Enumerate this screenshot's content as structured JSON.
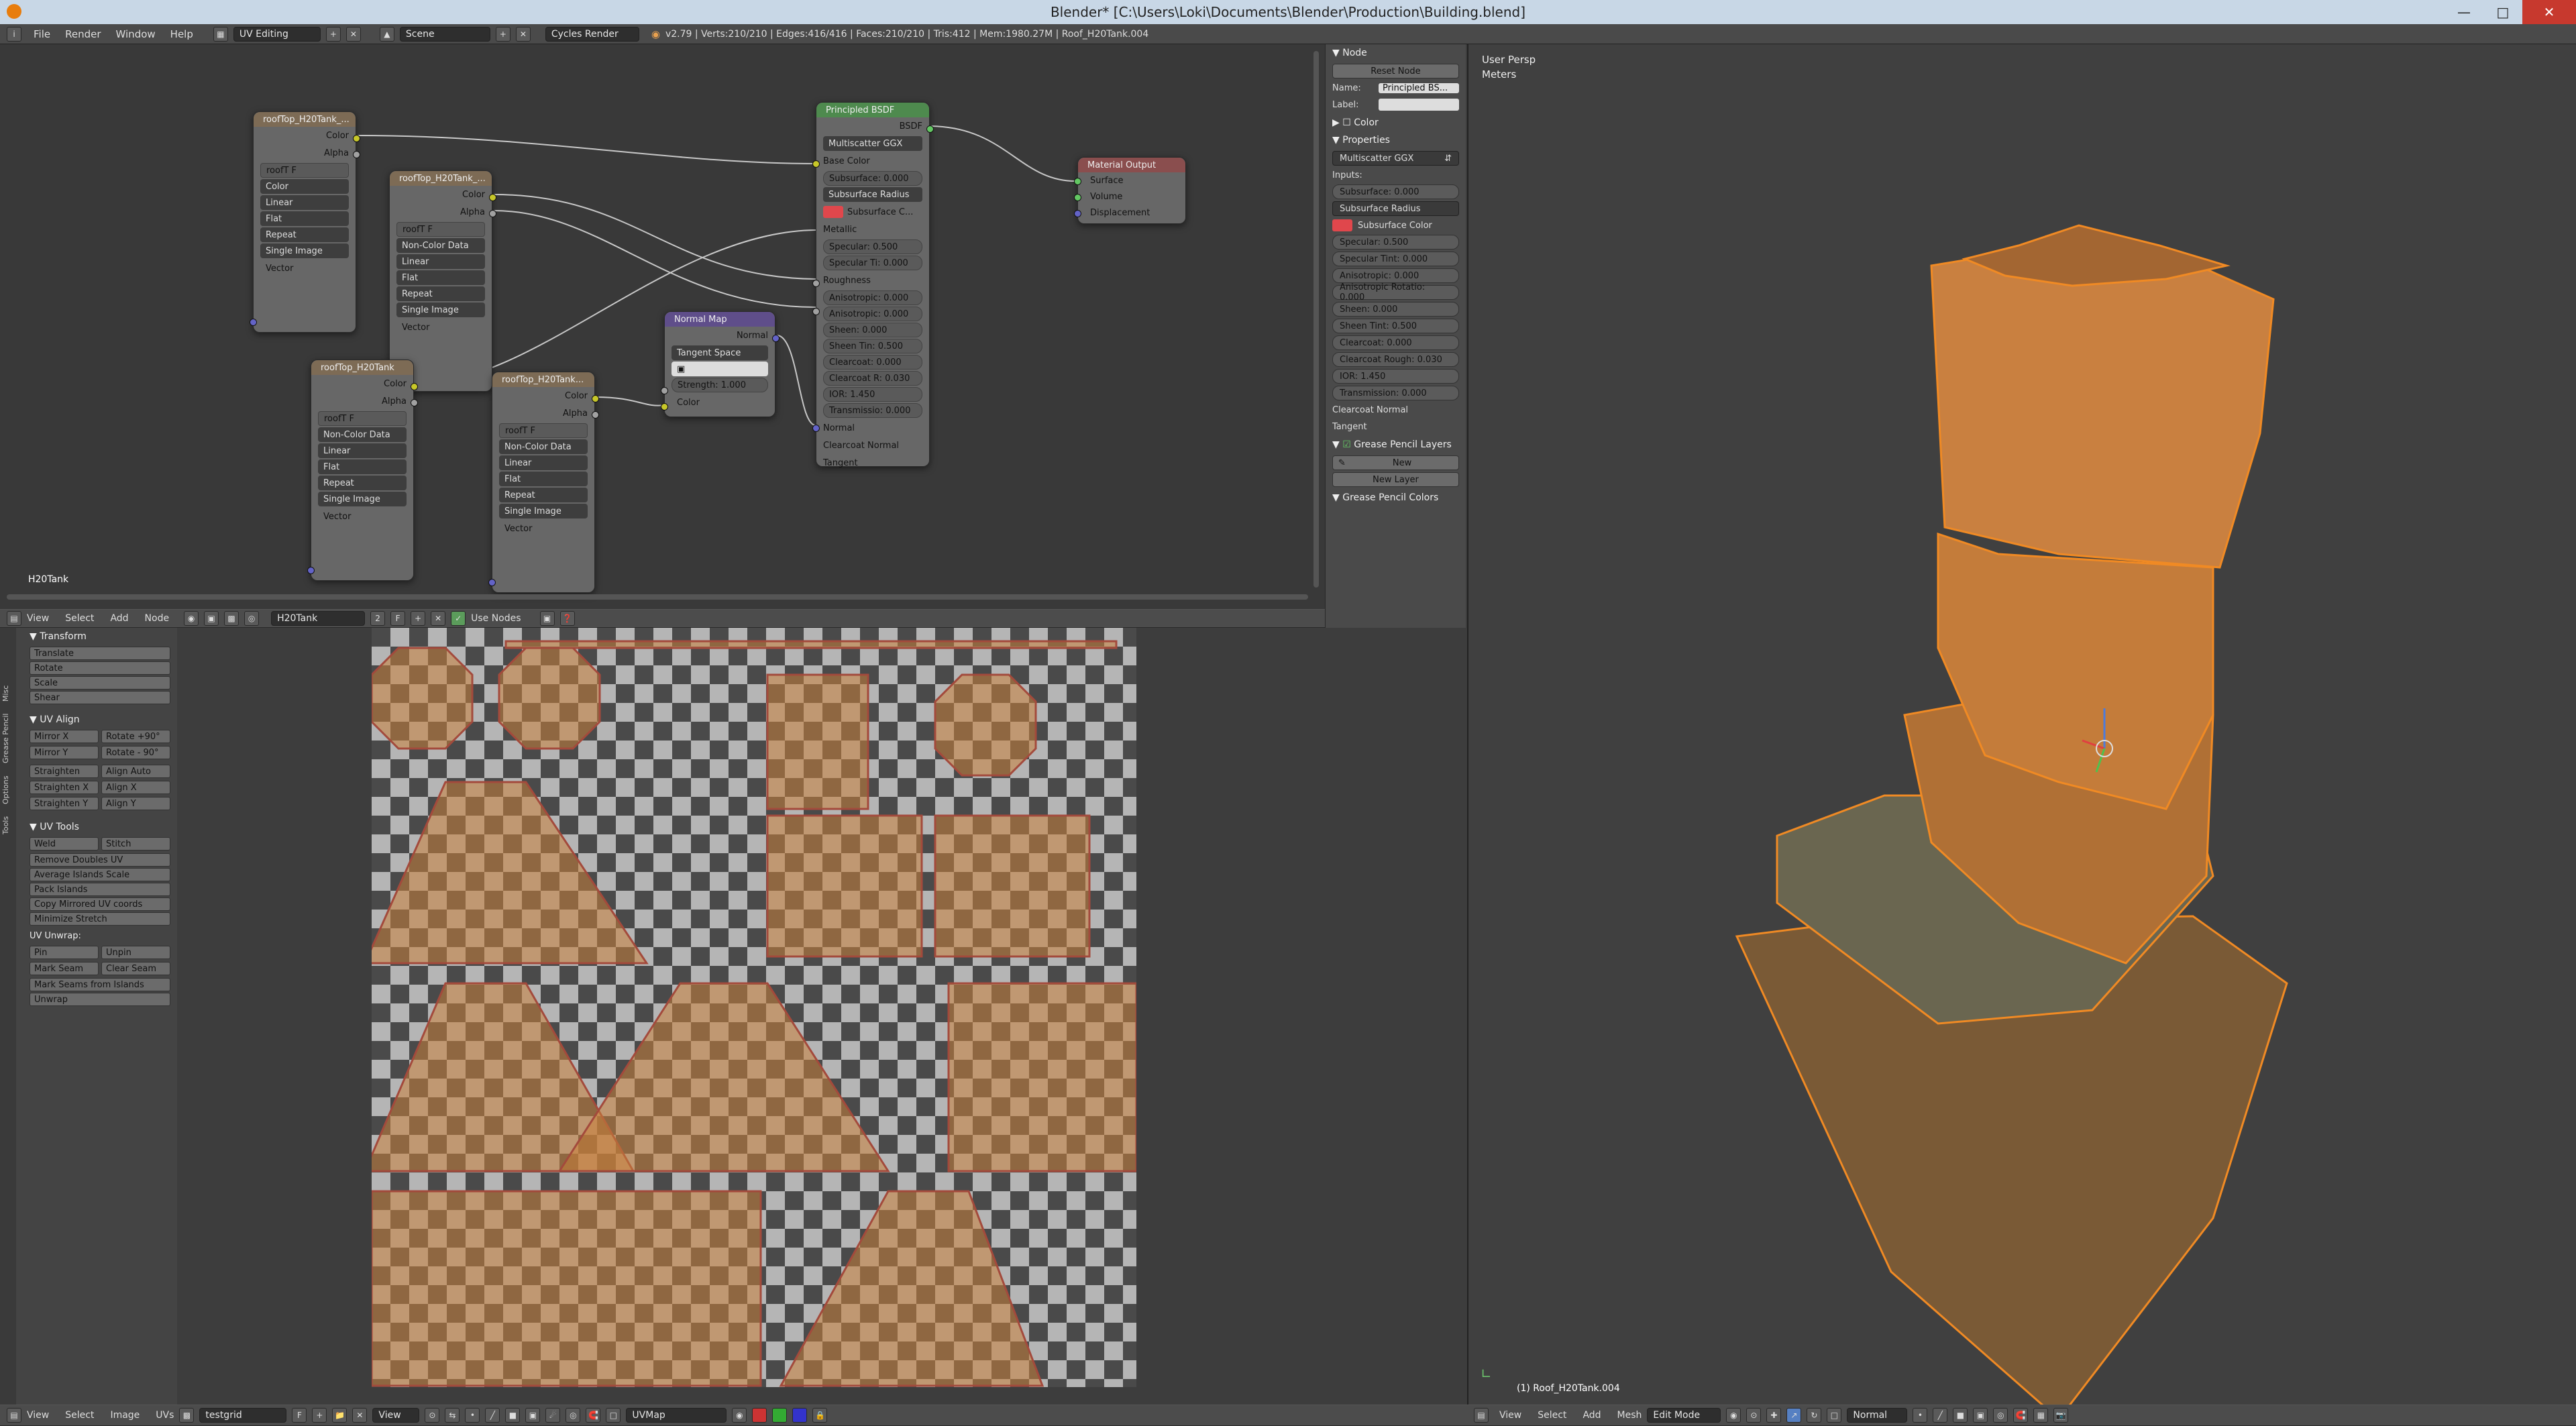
{
  "window": {
    "title": "Blender* [C:\\Users\\Loki\\Documents\\Blender\\Production\\Building.blend]"
  },
  "info": {
    "menu": [
      "File",
      "Render",
      "Window",
      "Help"
    ],
    "layout": "UV Editing",
    "scene": "Scene",
    "engine": "Cycles Render",
    "stats": "v2.79 | Verts:210/210 | Edges:416/416 | Faces:210/210 | Tris:412 | Mem:1980.27M | Roof_H20Tank.004"
  },
  "node_editor": {
    "label": "H20Tank",
    "menu": [
      "View",
      "Select",
      "Add",
      "Node"
    ],
    "material": "H20Tank",
    "use_nodes": "Use Nodes",
    "tex_nodes": [
      {
        "title": "roofTop_H20Tank_...",
        "img": "roofT",
        "flag": "F",
        "color_space": "Color",
        "interp": "Linear",
        "proj": "Flat",
        "ext": "Repeat",
        "src": "Single Image"
      },
      {
        "title": "roofTop_H20Tank_...",
        "img": "roofT",
        "flag": "F",
        "color_space": "Non-Color Data",
        "interp": "Linear",
        "proj": "Flat",
        "ext": "Repeat",
        "src": "Single Image"
      },
      {
        "title": "roofTop_H20Tank",
        "img": "roofT",
        "flag": "F",
        "color_space": "Non-Color Data",
        "interp": "Linear",
        "proj": "Flat",
        "ext": "Repeat",
        "src": "Single Image"
      },
      {
        "title": "roofTop_H20Tank...",
        "img": "roofT",
        "flag": "F",
        "color_space": "Non-Color Data",
        "interp": "Linear",
        "proj": "Flat",
        "ext": "Repeat",
        "src": "Single Image"
      }
    ],
    "socket_labels": {
      "color": "Color",
      "alpha": "Alpha",
      "vector": "Vector"
    },
    "bsdf": {
      "title": "Principled BSDF",
      "out": "BSDF",
      "dist": "Multiscatter GGX",
      "base_color": "Base Color",
      "subsurface": "Subsurface: 0.000",
      "sss_method": "Subsurface Radius",
      "sss_color": "Subsurface C...",
      "metallic": "Metallic",
      "specular": "Specular: 0.500",
      "spec_tint": "Specular Ti: 0.000",
      "roughness": "Roughness",
      "aniso": "Anisotropic: 0.000",
      "aniso_rot": "Anisotropic: 0.000",
      "sheen": "Sheen: 0.000",
      "sheen_tint": "Sheen Tin: 0.500",
      "clearcoat": "Clearcoat: 0.000",
      "clearcoat_r": "Clearcoat R: 0.030",
      "ior": "IOR: 1.450",
      "transmission": "Transmissio: 0.000",
      "normal": "Normal",
      "clearcoat_normal": "Clearcoat Normal",
      "tangent": "Tangent"
    },
    "normal_map": {
      "title": "Normal Map",
      "out": "Normal",
      "space": "Tangent Space",
      "strength": "Strength: 1.000",
      "color": "Color"
    },
    "output": {
      "title": "Material Output",
      "surface": "Surface",
      "volume": "Volume",
      "displacement": "Displacement"
    }
  },
  "props": {
    "node_header": "Node",
    "reset": "Reset Node",
    "name_label": "Name:",
    "name_value": "Principled BS...",
    "label_label": "Label:",
    "color": "Color",
    "properties": "Properties",
    "dist": "Multiscatter GGX",
    "inputs": "Inputs:",
    "fields": [
      "Subsurface: 0.000",
      "Subsurface Radius",
      "Subsurface Color",
      "Specular: 0.500",
      "Specular Tint: 0.000",
      "Anisotropic: 0.000",
      "Anisotropic Rotatio: 0.000",
      "Sheen: 0.000",
      "Sheen Tint: 0.500",
      "Clearcoat: 0.000",
      "Clearcoat Rough: 0.030",
      "IOR: 1.450",
      "Transmission: 0.000"
    ],
    "clearcoat_normal": "Clearcoat Normal",
    "tangent": "Tangent",
    "gp_layers": "Grease Pencil Layers",
    "new": "New",
    "new_layer": "New Layer",
    "gp_colors": "Grease Pencil Colors",
    "sss_color_hex": "#e0474c"
  },
  "uv_tools": {
    "tabs": [
      "Tools",
      "Options",
      "Grease Pencil",
      "Misc"
    ],
    "transform": "Transform",
    "transform_btns": [
      "Translate",
      "Rotate",
      "Scale",
      "Shear"
    ],
    "uv_align": "UV Align",
    "align_btns": [
      [
        "Mirror X",
        "Rotate +90°"
      ],
      [
        "Mirror Y",
        "Rotate - 90°"
      ],
      [
        "Straighten",
        "Align Auto"
      ],
      [
        "Straighten X",
        "Align X"
      ],
      [
        "Straighten Y",
        "Align Y"
      ]
    ],
    "uv_tools": "UV Tools",
    "weld": "Weld",
    "stitch": "Stitch",
    "tool_btns": [
      "Remove Doubles UV",
      "Average Islands Scale",
      "Pack Islands",
      "Copy Mirrored UV coords",
      "Minimize Stretch"
    ],
    "uv_unwrap": "UV Unwrap:",
    "pin": "Pin",
    "unpin": "Unpin",
    "mark_seam": "Mark Seam",
    "clear_seam": "Clear Seam",
    "seams_from_islands": "Mark Seams from Islands",
    "unwrap": "Unwrap"
  },
  "uv_footer": {
    "menu": [
      "View",
      "Select",
      "Image",
      "UVs"
    ],
    "image": "testgrid",
    "view": "View",
    "uvmap": "UVMap"
  },
  "viewport": {
    "persp": "User Persp",
    "units": "Meters",
    "object": "(1) Roof_H20Tank.004",
    "menu": [
      "View",
      "Select",
      "Add",
      "Mesh"
    ],
    "mode": "Edit Mode",
    "orientation": "Normal"
  },
  "colors": {
    "accent_orange": "#f08a24",
    "mesh_fill": "#c8803a"
  }
}
